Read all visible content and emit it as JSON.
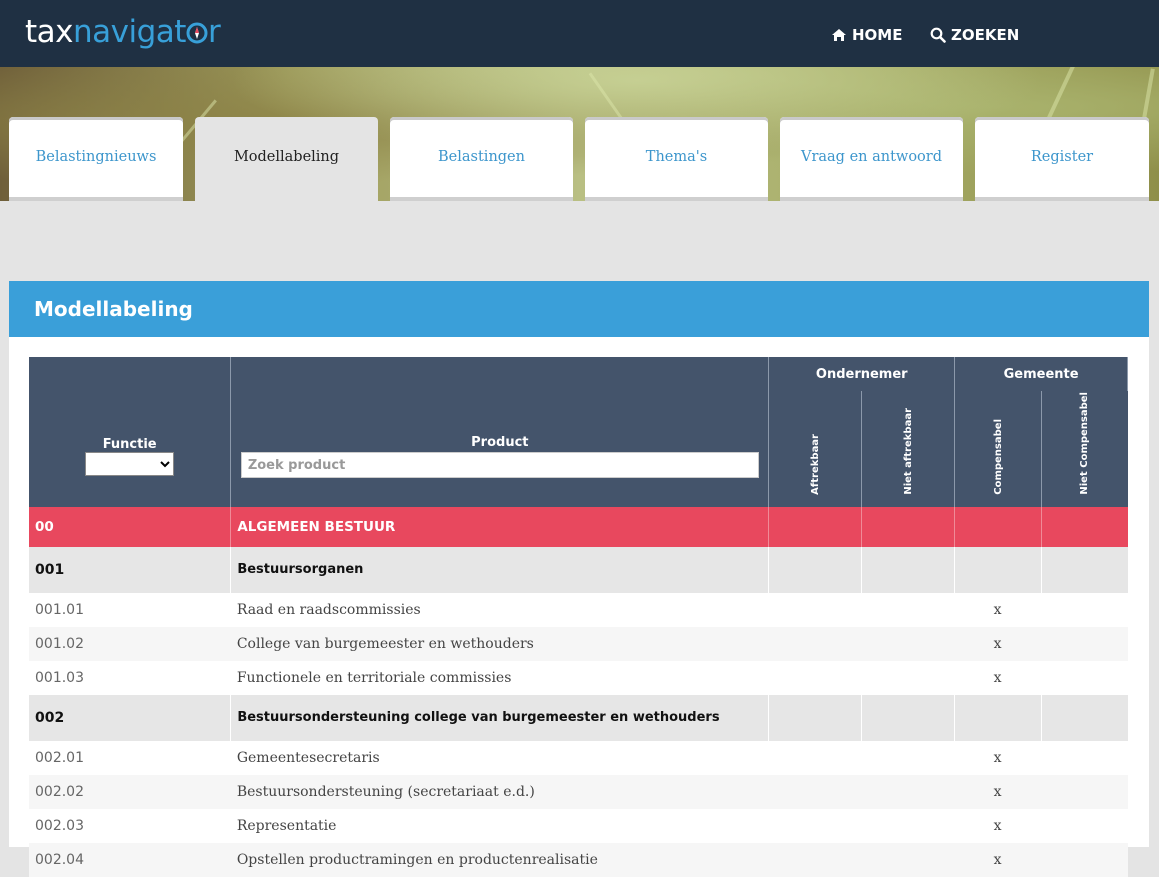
{
  "brand": {
    "part1": "tax",
    "part2": "navigat",
    "part3": "r"
  },
  "topnav": {
    "home": "HOME",
    "search": "ZOEKEN"
  },
  "tabs": [
    {
      "label": "Belastingnieuws",
      "active": false
    },
    {
      "label": "Modellabeling",
      "active": true
    },
    {
      "label": "Belastingen",
      "active": false
    },
    {
      "label": "Thema's",
      "active": false
    },
    {
      "label": "Vraag en antwoord",
      "active": false
    },
    {
      "label": "Register",
      "active": false
    }
  ],
  "card": {
    "title": "Modellabeling"
  },
  "table": {
    "functie_label": "Functie",
    "functie_value": "",
    "product_label": "Product",
    "product_placeholder": "Zoek product",
    "ondernemer_label": "Ondernemer",
    "gemeente_label": "Gemeente",
    "col_aftrekbaar": "Aftrekbaar",
    "col_niet_aftrekbaar": "Niet aftrekbaar",
    "col_compensabel": "Compensabel",
    "col_niet_compensabel": "Niet Compensabel",
    "group": {
      "code": "00",
      "name": "ALGEMEEN BESTUUR"
    },
    "sections": [
      {
        "code": "001",
        "name": "Bestuursorganen",
        "rows": [
          {
            "code": "001.01",
            "name": "Raad en raadscommissies",
            "compensabel": "x"
          },
          {
            "code": "001.02",
            "name": "College van burgemeester en wethouders",
            "compensabel": "x"
          },
          {
            "code": "001.03",
            "name": "Functionele en territoriale commissies",
            "compensabel": "x"
          }
        ]
      },
      {
        "code": "002",
        "name": "Bestuursondersteuning college van burgemeester en wethouders",
        "rows": [
          {
            "code": "002.01",
            "name": "Gemeentesecretaris",
            "compensabel": "x"
          },
          {
            "code": "002.02",
            "name": "Bestuursondersteuning (secretariaat e.d.)",
            "compensabel": "x"
          },
          {
            "code": "002.03",
            "name": "Representatie",
            "compensabel": "x"
          },
          {
            "code": "002.04",
            "name": "Opstellen productramingen en productenrealisatie",
            "compensabel": "x"
          }
        ]
      }
    ]
  }
}
